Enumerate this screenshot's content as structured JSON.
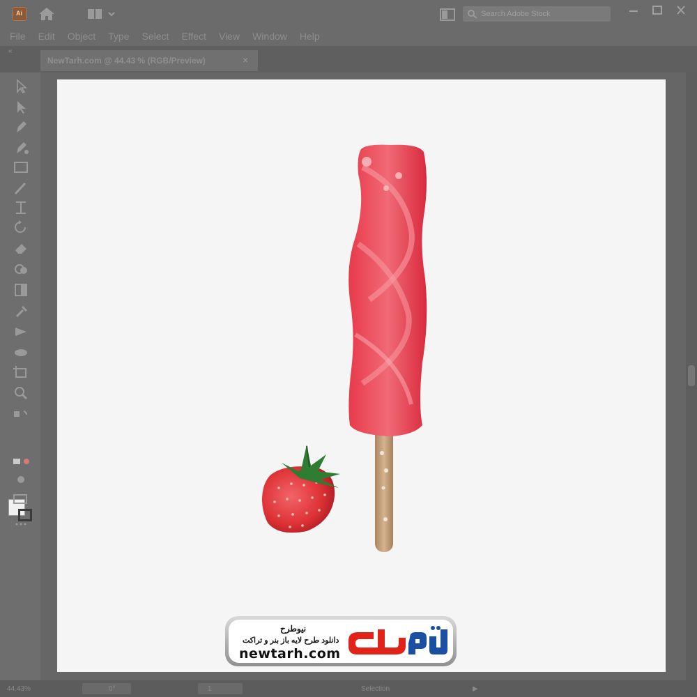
{
  "app": {
    "logo_text": "Ai",
    "search_placeholder": "Search Adobe Stock",
    "menu": [
      "File",
      "Edit",
      "Object",
      "Type",
      "Select",
      "Effect",
      "View",
      "Window",
      "Help"
    ]
  },
  "document_tab": {
    "title": "NewTarh.com @ 44.43 % (RGB/Preview)",
    "close_label": "×"
  },
  "panel_collapse_label": "«",
  "status": {
    "zoom": "44.43%",
    "rotation": "0°",
    "artboard_number": "1",
    "mode": "Selection"
  },
  "colors": {
    "fill": "#f0f0f0",
    "stroke": "#3a3a3a",
    "popsicle": "#e8374a",
    "stick": "#c7a27a",
    "strawberry": "#e03a3e"
  },
  "watermark": {
    "brand_fa": "نیوطرح",
    "tagline_fa": "دانلود طرح لایه باز بنر و تراکت",
    "url": "newtarh.com"
  }
}
